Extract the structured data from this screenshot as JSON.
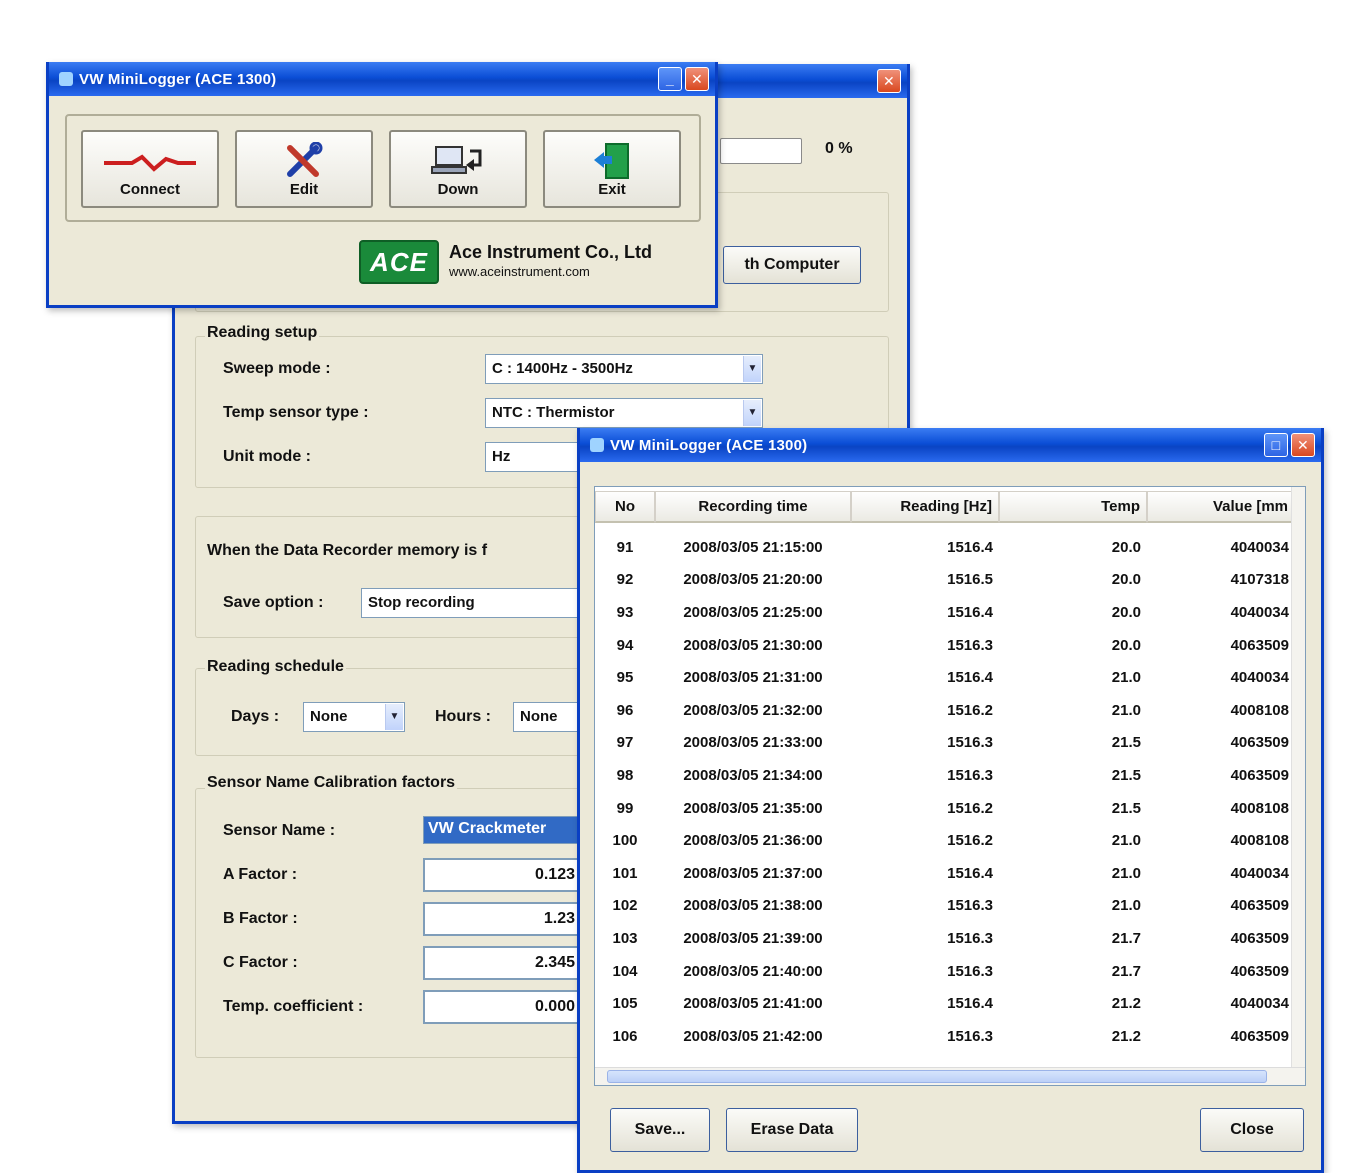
{
  "settings_window": {
    "percent_label": "0 %",
    "sync_button": "th Computer",
    "reading_setup": {
      "title": "Reading setup",
      "sweep_label": "Sweep mode :",
      "sweep_value": "C : 1400Hz - 3500Hz",
      "temp_label": "Temp sensor type :",
      "temp_value": "NTC : Thermistor",
      "unit_label": "Unit mode :",
      "unit_value": "Hz"
    },
    "memory": {
      "title": "When the Data Recorder memory is f",
      "save_label": "Save option :",
      "save_value": "Stop recording"
    },
    "schedule": {
      "title": "Reading schedule",
      "days_label": "Days :",
      "days_value": "None",
      "hours_label": "Hours :",
      "hours_value": "None"
    },
    "calibration": {
      "title": "Sensor Name  Calibration factors",
      "sensor_label": "Sensor Name :",
      "sensor_value": "VW Crackmeter",
      "a_label": "A Factor :",
      "a_value": "0.123",
      "b_label": "B Factor :",
      "b_value": "1.23",
      "c_label": "C Factor :",
      "c_value": "2.345",
      "tc_label": "Temp. coefficient :",
      "tc_value": "0.000"
    }
  },
  "launcher_window": {
    "title": "VW MiniLogger (ACE 1300)",
    "tools": [
      {
        "label": "Connect",
        "icon": "signal-graph-icon"
      },
      {
        "label": "Edit",
        "icon": "tools-icon"
      },
      {
        "label": "Down",
        "icon": "download-icon"
      },
      {
        "label": "Exit",
        "icon": "exit-door-icon"
      }
    ],
    "brand": {
      "badge": "ACE",
      "name": "Ace Instrument Co., Ltd",
      "url": "www.aceinstrument.com"
    }
  },
  "data_window": {
    "title": "VW MiniLogger (ACE 1300)",
    "columns": [
      "No",
      "Recording time",
      "Reading [Hz]",
      "Temp",
      "Value [mm"
    ],
    "rows": [
      [
        "91",
        "2008/03/05 21:15:00",
        "1516.4",
        "20.0",
        "4040034"
      ],
      [
        "92",
        "2008/03/05 21:20:00",
        "1516.5",
        "20.0",
        "4107318"
      ],
      [
        "93",
        "2008/03/05 21:25:00",
        "1516.4",
        "20.0",
        "4040034"
      ],
      [
        "94",
        "2008/03/05 21:30:00",
        "1516.3",
        "20.0",
        "4063509"
      ],
      [
        "95",
        "2008/03/05 21:31:00",
        "1516.4",
        "21.0",
        "4040034"
      ],
      [
        "96",
        "2008/03/05 21:32:00",
        "1516.2",
        "21.0",
        "4008108"
      ],
      [
        "97",
        "2008/03/05 21:33:00",
        "1516.3",
        "21.5",
        "4063509"
      ],
      [
        "98",
        "2008/03/05 21:34:00",
        "1516.3",
        "21.5",
        "4063509"
      ],
      [
        "99",
        "2008/03/05 21:35:00",
        "1516.2",
        "21.5",
        "4008108"
      ],
      [
        "100",
        "2008/03/05 21:36:00",
        "1516.2",
        "21.0",
        "4008108"
      ],
      [
        "101",
        "2008/03/05 21:37:00",
        "1516.4",
        "21.0",
        "4040034"
      ],
      [
        "102",
        "2008/03/05 21:38:00",
        "1516.3",
        "21.0",
        "4063509"
      ],
      [
        "103",
        "2008/03/05 21:39:00",
        "1516.3",
        "21.7",
        "4063509"
      ],
      [
        "104",
        "2008/03/05 21:40:00",
        "1516.3",
        "21.7",
        "4063509"
      ],
      [
        "105",
        "2008/03/05 21:41:00",
        "1516.4",
        "21.2",
        "4040034"
      ],
      [
        "106",
        "2008/03/05 21:42:00",
        "1516.3",
        "21.2",
        "4063509"
      ]
    ],
    "buttons": {
      "save": "Save...",
      "erase": "Erase Data",
      "close": "Close"
    }
  },
  "colors": {
    "titlebar": "#0a44c4",
    "window_bg": "#ece9d8",
    "selection": "#316ac5",
    "brand_green": "#1a8a3a"
  }
}
